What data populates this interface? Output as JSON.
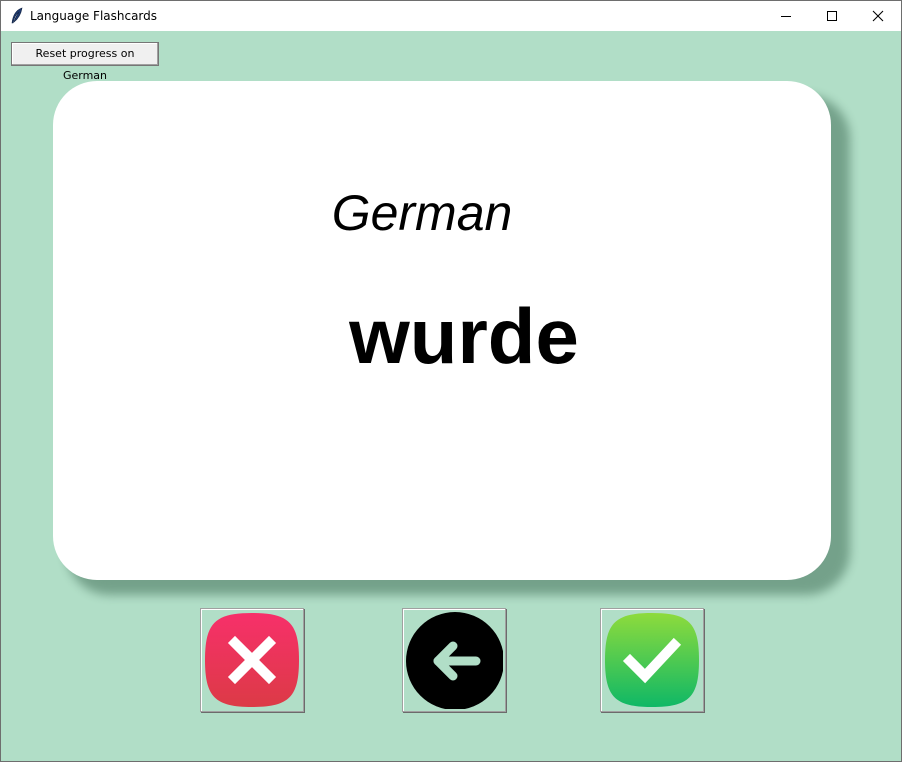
{
  "window": {
    "title": "Language Flashcards",
    "icons": {
      "app": "feather-icon",
      "minimize": "minimize-icon",
      "maximize": "maximize-icon",
      "close": "close-icon"
    }
  },
  "toolbar": {
    "reset_label": "Reset progress on German"
  },
  "card": {
    "language": "German",
    "word": "wurde"
  },
  "actions": {
    "wrong": {
      "icon": "x-mark-icon",
      "color": "#e8335a"
    },
    "back": {
      "icon": "arrow-left-icon",
      "color": "#000000"
    },
    "right": {
      "icon": "check-mark-icon",
      "color": "#2cc45a"
    }
  },
  "colors": {
    "background": "#b1dec7",
    "card": "#ffffff"
  }
}
